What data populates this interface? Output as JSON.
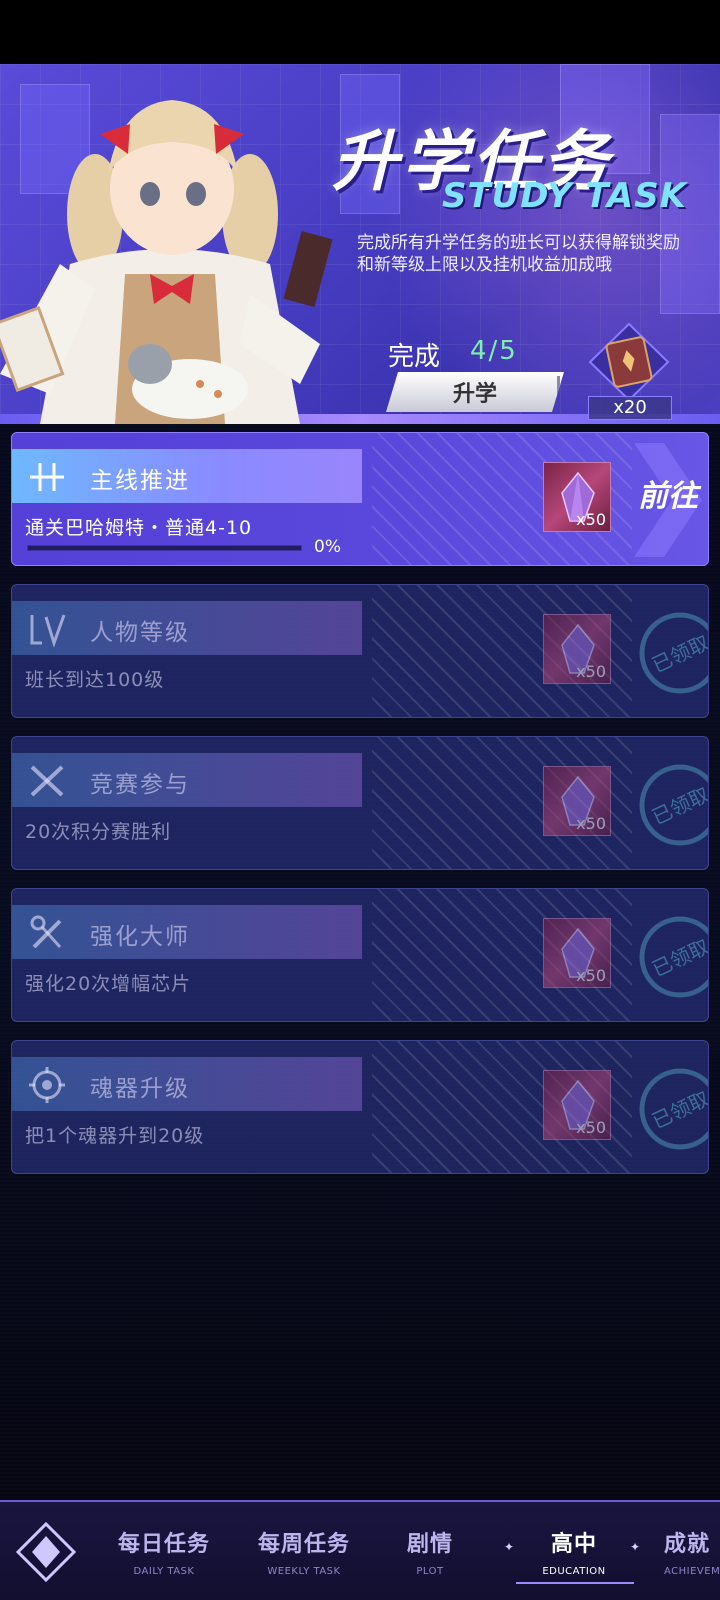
{
  "banner": {
    "title_cn": "升学任务",
    "title_en": "STUDY TASK",
    "description": "完成所有升学任务的班长可以获得解锁奖励和新等级上限以及挂机收益加成哦",
    "completed_label": "完成",
    "completed_value": "4/5",
    "promote_button": "升学",
    "reward_count": "x20"
  },
  "tasks": [
    {
      "title": "主线推进",
      "desc": "通关巴哈姆特・普通4-10",
      "progress_text": "0%",
      "progress": 0,
      "reward_qty": "x50",
      "action": "前往",
      "status": "active",
      "icon": "crosshair-icon"
    },
    {
      "title": "人物等级",
      "desc": "班长到达100级",
      "reward_qty": "x50",
      "status": "claimed",
      "stamp": "已领取",
      "icon": "level-icon"
    },
    {
      "title": "竞赛参与",
      "desc": "20次积分赛胜利",
      "reward_qty": "x50",
      "status": "claimed",
      "stamp": "已领取",
      "icon": "crossed-guns-icon"
    },
    {
      "title": "强化大师",
      "desc": "强化20次增幅芯片",
      "reward_qty": "x50",
      "status": "claimed",
      "stamp": "已领取",
      "icon": "crossed-tools-icon"
    },
    {
      "title": "魂器升级",
      "desc": "把1个魂器升到20级",
      "reward_qty": "x50",
      "status": "claimed",
      "stamp": "已领取",
      "icon": "soul-gear-icon"
    }
  ],
  "nav": {
    "items": [
      {
        "cn": "每日任务",
        "en": "DAILY TASK"
      },
      {
        "cn": "每周任务",
        "en": "WEEKLY TASK"
      },
      {
        "cn": "剧情",
        "en": "PLOT"
      },
      {
        "cn": "高中",
        "en": "EDUCATION"
      },
      {
        "cn": "成就",
        "en": "ACHIEVEMENT"
      }
    ],
    "active_index": 3
  },
  "colors": {
    "accent": "#5a48dc",
    "progress_green": "#7ff0b0",
    "title_cyan": "#7fe3ff"
  }
}
